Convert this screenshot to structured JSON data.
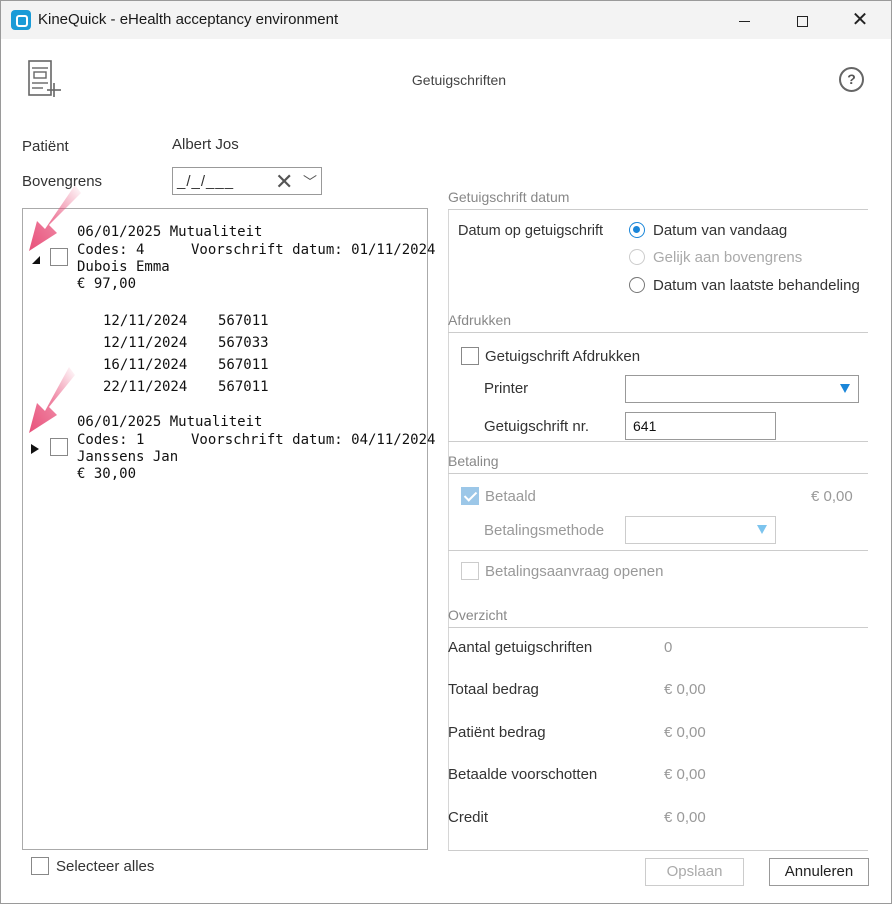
{
  "window": {
    "title": "KineQuick - eHealth acceptancy environment",
    "min_label": "",
    "close_label": "✕"
  },
  "header": {
    "title": "Getuigschriften",
    "help_label": "?"
  },
  "form": {
    "patient_label": "Patiënt",
    "patient_value": "Albert Jos",
    "bovengrens_label": "Bovengrens",
    "bovengrens_value": "_/_/___"
  },
  "entries": [
    {
      "line1": "06/01/2025 Mutualiteit",
      "codes": "Codes: 4",
      "voorschrift": "Voorschrift datum: 01/11/2024",
      "name": "Dubois Emma",
      "amount": "€ 97,00",
      "expanded": true,
      "rows": [
        {
          "date": "12/11/2024",
          "code": "567011"
        },
        {
          "date": "12/11/2024",
          "code": "567033"
        },
        {
          "date": "16/11/2024",
          "code": "567011"
        },
        {
          "date": "22/11/2024",
          "code": "567011"
        }
      ]
    },
    {
      "line1": "06/01/2025 Mutualiteit",
      "codes": "Codes: 1",
      "voorschrift": "Voorschrift datum: 04/11/2024",
      "name": "Janssens Jan",
      "amount": "€ 30,00",
      "expanded": false,
      "rows": []
    }
  ],
  "select_all_label": "Selecteer alles",
  "datum_section": {
    "title": "Getuigschrift datum",
    "label": "Datum op getuigschrift",
    "options": [
      "Datum van vandaag",
      "Gelijk aan bovengrens",
      "Datum van laatste behandeling"
    ],
    "selected": "Datum van vandaag"
  },
  "afdrukken_section": {
    "title": "Afdrukken",
    "print_label": "Getuigschrift Afdrukken",
    "printer_label": "Printer",
    "printer_value": "",
    "nr_label": "Getuigschrift nr.",
    "nr_value": "641"
  },
  "betaling_section": {
    "title": "Betaling",
    "betaald_label": "Betaald",
    "betaald_amount": "€ 0,00",
    "methode_label": "Betalingsmethode",
    "methode_value": "",
    "aanvraag_label": "Betalingsaanvraag openen"
  },
  "overzicht_section": {
    "title": "Overzicht",
    "rows": [
      {
        "label": "Aantal getuigschriften",
        "value": "0"
      },
      {
        "label": "Totaal bedrag",
        "value": "€ 0,00"
      },
      {
        "label": "Patiënt bedrag",
        "value": "€ 0,00"
      },
      {
        "label": "Betaalde voorschotten",
        "value": "€ 0,00"
      },
      {
        "label": "Credit",
        "value": "€ 0,00"
      }
    ]
  },
  "buttons": {
    "save": "Opslaan",
    "cancel": "Annuleren"
  },
  "colors": {
    "accent": "#1a86d9",
    "arrow": "#e8507a",
    "app_icon": "#1a9bd7"
  },
  "icons": {
    "app": "kinequick-logo-icon",
    "header": "certificate-list-add-icon",
    "help": "help-icon",
    "clear": "clear-x-icon",
    "dropdown": "chevron-down-icon"
  }
}
